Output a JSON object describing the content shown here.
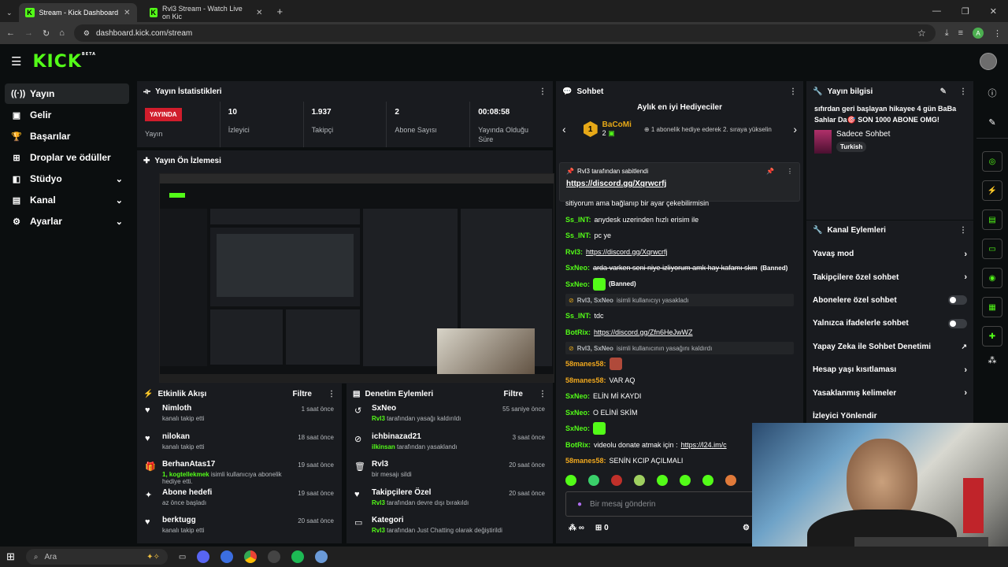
{
  "browser": {
    "tabs": [
      {
        "title": "Stream - Kick Dashboard",
        "active": true
      },
      {
        "title": "Rvl3 Stream - Watch Live on Kic",
        "active": false
      }
    ],
    "url": "dashboard.kick.com/stream",
    "profile_letter": "A"
  },
  "brand": {
    "logo": "KICK",
    "beta": "BETA",
    "accent": "#53fc18"
  },
  "sidebar": {
    "items": [
      {
        "label": "Yayın",
        "icon": "broadcast-icon",
        "glyph": "((·))",
        "active": true,
        "expand": false
      },
      {
        "label": "Gelir",
        "icon": "money-icon",
        "glyph": "▣",
        "active": false,
        "expand": false
      },
      {
        "label": "Başarılar",
        "icon": "trophy-icon",
        "glyph": "🏆",
        "active": false,
        "expand": false
      },
      {
        "label": "Droplar ve ödüller",
        "icon": "gift-icon",
        "glyph": "⊞",
        "active": false,
        "expand": false
      },
      {
        "label": "Stüdyo",
        "icon": "studio-icon",
        "glyph": "◧",
        "active": false,
        "expand": true
      },
      {
        "label": "Kanal",
        "icon": "channel-icon",
        "glyph": "▤",
        "active": false,
        "expand": true
      },
      {
        "label": "Ayarlar",
        "icon": "gear-icon",
        "glyph": "⚙",
        "active": false,
        "expand": true
      }
    ]
  },
  "stats_panel": {
    "title": "Yayın İstatistikleri",
    "live_badge": "YAYINDA",
    "live_label": "Yayın",
    "stats": [
      {
        "value": "10",
        "label": "İzleyici"
      },
      {
        "value": "1.937",
        "label": "Takipçi"
      },
      {
        "value": "2",
        "label": "Abone Sayısı"
      },
      {
        "value": "00:08:58",
        "label": "Yayında Olduğu Süre"
      }
    ]
  },
  "preview_panel": {
    "title": "Yayın Ön İzlemesi"
  },
  "activity_panel": {
    "title": "Etkinlik Akışı",
    "filter": "Filtre",
    "items": [
      {
        "name": "Nimloth",
        "desc": "kanalı takip etti",
        "highlight": "",
        "time": "1 saat önce",
        "icon": "heart-icon",
        "glyph": "♥"
      },
      {
        "name": "nilokan",
        "desc": "kanalı takip etti",
        "highlight": "",
        "time": "18 saat önce",
        "icon": "heart-icon",
        "glyph": "♥"
      },
      {
        "name": "BerhanAtas17",
        "highlight": "1, kogtellekmek",
        "desc": " isimli kullanıcıya abonelik hediye etti.",
        "time": "19 saat önce",
        "icon": "gift-icon",
        "glyph": "🎁"
      },
      {
        "name": "Abone hedefi",
        "desc": "az önce başladı",
        "highlight": "",
        "time": "19 saat önce",
        "icon": "sparkle-icon",
        "glyph": "✦"
      },
      {
        "name": "berktugg",
        "desc": "kanalı takip etti",
        "highlight": "",
        "time": "20 saat önce",
        "icon": "heart-icon",
        "glyph": "♥"
      }
    ]
  },
  "moderation_panel": {
    "title": "Denetim Eylemleri",
    "filter": "Filtre",
    "items": [
      {
        "name": "SxNeo",
        "highlight": "Rvl3",
        "desc": " tarafından yasağı kaldırıldı",
        "time": "55 saniye önce",
        "icon": "undo-icon",
        "glyph": "↺"
      },
      {
        "name": "ichbinazad21",
        "highlight": "ilkinsan",
        "desc": " tarafından yasaklandı",
        "time": "3 saat önce",
        "icon": "ban-icon",
        "glyph": "⊘"
      },
      {
        "name": "Rvl3",
        "highlight": "",
        "desc": "bir mesajı sildi",
        "time": "20 saat önce",
        "icon": "trash-icon",
        "glyph": "🗑"
      },
      {
        "name": "Takipçilere Özel",
        "highlight": "Rvl3",
        "desc": " tarafından devre dışı bırakıldı",
        "time": "20 saat önce",
        "icon": "heart-icon",
        "glyph": "♥"
      },
      {
        "name": "Kategori",
        "highlight": "Rvl3",
        "desc": " tarafından  Just Chatting olarak değiştirildi",
        "time": "",
        "icon": "category-icon",
        "glyph": "▭"
      }
    ]
  },
  "chat_panel": {
    "title": "Sohbet",
    "gifters_title": "Aylık en iyi Hediyeciler",
    "top_gifter": {
      "rank": "1",
      "name": "BaCoMi",
      "count": "2"
    },
    "gifter_hint": "1 abonelik hediye ederek 2. sıraya yükselin",
    "pinned_by": "Rvl3 tarafından sabitlendi",
    "pinned_link": "https://discord.gg/Xqrwcrfj",
    "messages": [
      {
        "user": "",
        "color": "#fff",
        "text": "sitiyorum ama bağlanıp bir ayar çekebilirmisin",
        "link": "",
        "extra": "",
        "type": "msg"
      },
      {
        "user": "Ss_INT:",
        "color": "#53fc18",
        "text": "anydesk uzerinden hızlı erisim ile",
        "link": "",
        "extra": "",
        "type": "msg"
      },
      {
        "user": "Ss_INT:",
        "color": "#53fc18",
        "text": "pc ye",
        "link": "",
        "extra": "",
        "type": "msg"
      },
      {
        "user": "Rvl3:",
        "color": "#53fc18",
        "text": "",
        "link": "https://discord.gg/Xqrwcrfj",
        "extra": "",
        "type": "msg"
      },
      {
        "user": "SxNeo:",
        "color": "#53fc18",
        "text": "arda varken seni niye izliyorum amk hay kafamı skm",
        "link": "",
        "extra": "(Banned)",
        "type": "banned"
      },
      {
        "user": "SxNeo:",
        "color": "#53fc18",
        "text": "",
        "link": "",
        "extra": "(Banned)",
        "type": "emote"
      },
      {
        "user": "Rvl3, SxNeo",
        "color": "#b4b8bc",
        "text": "isimli kullanıcıyı yasakladı",
        "link": "",
        "extra": "",
        "type": "sys"
      },
      {
        "user": "Ss_INT:",
        "color": "#53fc18",
        "text": "tdc",
        "link": "",
        "extra": "",
        "type": "msg"
      },
      {
        "user": "BotRix:",
        "color": "#53fc18",
        "text": "",
        "link": "https://discord.gg/Zfn6HeJwWZ",
        "extra": "",
        "type": "msg"
      },
      {
        "user": "Rvl3, SxNeo",
        "color": "#b4b8bc",
        "text": "isimli kullanıcının yasağını kaldırdı",
        "link": "",
        "extra": "",
        "type": "sys"
      },
      {
        "user": "58manes58:",
        "color": "#f0a81e",
        "text": "",
        "link": "",
        "extra": "",
        "type": "emote"
      },
      {
        "user": "58manes58:",
        "color": "#f0a81e",
        "text": "VAR AQ",
        "link": "",
        "extra": "",
        "type": "msg"
      },
      {
        "user": "SxNeo:",
        "color": "#53fc18",
        "text": "ELİN Mİ KAYDI",
        "link": "",
        "extra": "",
        "type": "msg"
      },
      {
        "user": "SxNeo:",
        "color": "#53fc18",
        "text": "O ELİNİ SKİM",
        "link": "",
        "extra": "",
        "type": "msg"
      },
      {
        "user": "SxNeo:",
        "color": "#53fc18",
        "text": "",
        "link": "",
        "extra": "",
        "type": "emote"
      },
      {
        "user": "BotRix:",
        "color": "#53fc18",
        "text": "videolu donate atmak için :",
        "link": "https://l24.im/c",
        "extra": "",
        "type": "msg"
      },
      {
        "user": "58manes58:",
        "color": "#f0a81e",
        "text": "SENİN KCIP AÇILMALI",
        "link": "",
        "extra": "",
        "type": "msg"
      }
    ],
    "input_placeholder": "Bir mesaj gönderin",
    "infinity": "∞",
    "points": "0"
  },
  "stream_info_panel": {
    "title": "Yayın bilgisi",
    "stream_title": "sıfırdan geri başlayan hikayee 4 gün BaBa Sahlar Da🎯 SON 1000 ABONE OMG!",
    "category": "Sadece Sohbet",
    "tag": "Turkish"
  },
  "channel_actions_panel": {
    "title": "Kanal Eylemleri",
    "items": [
      {
        "label": "Yavaş mod",
        "control": "chevron"
      },
      {
        "label": "Takipçilere özel sohbet",
        "control": "chevron"
      },
      {
        "label": "Abonelere özel sohbet",
        "control": "toggle"
      },
      {
        "label": "Yalnızca ifadelerle sohbet",
        "control": "toggle"
      },
      {
        "label": "Yapay Zeka ile Sohbet Denetimi",
        "control": "external"
      },
      {
        "label": "Hesap yaşı kısıtlaması",
        "control": "chevron"
      },
      {
        "label": "Yasaklanmış kelimeler",
        "control": "chevron"
      },
      {
        "label": "İzleyici Yönlendir",
        "control": "none"
      }
    ]
  },
  "taskbar": {
    "search_placeholder": "Ara"
  }
}
